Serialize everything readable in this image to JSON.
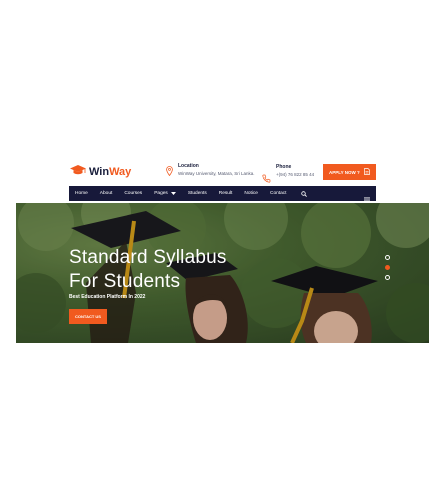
{
  "brand": {
    "name_part1": "Win",
    "name_part2": "Way",
    "accent_color": "#f15a1f",
    "dark_color": "#17193a"
  },
  "header": {
    "location_title": "Location",
    "location_value": "WinWay University, Matara, Sri Lanka.",
    "phone_title": "Phone",
    "phone_value": "+(94) 76 822 85 44",
    "apply_label": "APPLY NOW ?"
  },
  "nav": {
    "items": [
      "Home",
      "About",
      "Courses",
      "Pages",
      "Students",
      "Result",
      "Notice",
      "Contact"
    ]
  },
  "hero": {
    "title_line1": "Standard Syllabus",
    "title_line2": "For Students",
    "subtitle": "Best Education Platform In 2022",
    "button_label": "CONTACT US"
  },
  "icons": {
    "logo": "graduation-cap-icon",
    "location": "map-pin-icon",
    "phone": "phone-icon",
    "apply": "document-icon",
    "dropdown": "chevron-down-icon",
    "search": "search-icon",
    "menu": "hamburger-menu-icon"
  }
}
